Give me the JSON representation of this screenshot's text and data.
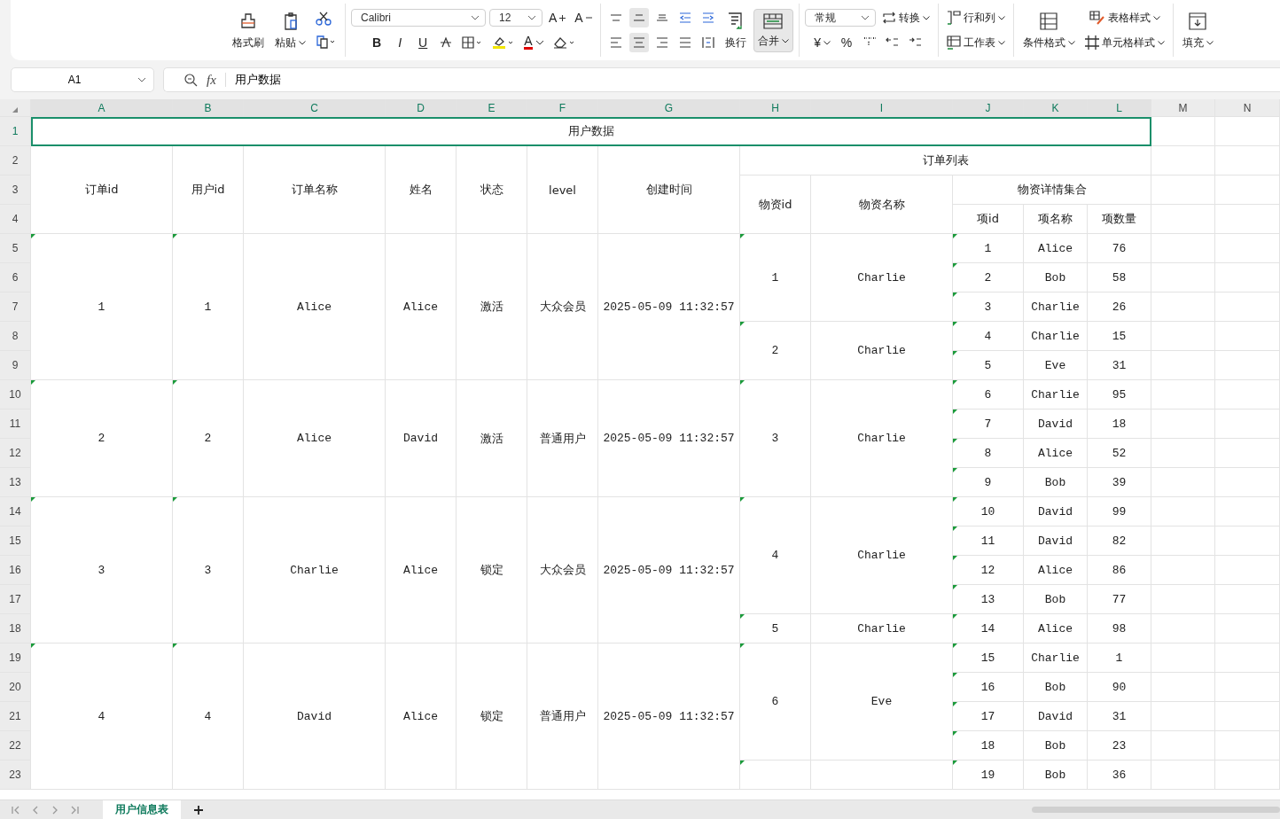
{
  "toolbar": {
    "format_painter": "格式刷",
    "paste": "粘贴",
    "font": "Calibri",
    "font_size": "12",
    "bold": "B",
    "italic": "I",
    "underline": "U",
    "font_grow": "A",
    "font_shrink": "A",
    "font_color": "A",
    "valign": [
      {
        "selected": false
      },
      {
        "selected": true
      },
      {
        "selected": false
      }
    ],
    "halign": [
      {
        "selected": false
      },
      {
        "selected": true
      },
      {
        "selected": false
      },
      {
        "selected": false
      }
    ],
    "wrap": "换行",
    "merge": {
      "label": "合并",
      "selected": true
    },
    "number_format": "常规",
    "convert": "转换",
    "currency": "¥",
    "percent": "%",
    "rows_cols": "行和列",
    "worksheet": "工作表",
    "conditional": "条件格式",
    "table_style": "表格样式",
    "cell_style": "单元格样式",
    "fill": "填充"
  },
  "formula_bar": {
    "cell_ref": "A1",
    "fx": "fx",
    "formula": "用户数据"
  },
  "sheet": {
    "columns": [
      {
        "label": "A",
        "selected": true
      },
      {
        "label": "B",
        "selected": true
      },
      {
        "label": "C",
        "selected": true
      },
      {
        "label": "D",
        "selected": true
      },
      {
        "label": "E",
        "selected": true
      },
      {
        "label": "F",
        "selected": true
      },
      {
        "label": "G",
        "selected": true
      },
      {
        "label": "H",
        "selected": true
      },
      {
        "label": "I",
        "selected": true
      },
      {
        "label": "J",
        "selected": true
      },
      {
        "label": "K",
        "selected": true
      },
      {
        "label": "L",
        "selected": true
      },
      {
        "label": "M",
        "selected": false
      },
      {
        "label": "N",
        "selected": false
      }
    ],
    "rows": [
      {
        "label": "1",
        "selected": true
      },
      {
        "label": "2",
        "selected": false
      },
      {
        "label": "3",
        "selected": false
      },
      {
        "label": "4",
        "selected": false
      },
      {
        "label": "5",
        "selected": false
      },
      {
        "label": "6",
        "selected": false
      },
      {
        "label": "7",
        "selected": false
      },
      {
        "label": "8",
        "selected": false
      },
      {
        "label": "9",
        "selected": false
      },
      {
        "label": "10",
        "selected": false
      },
      {
        "label": "11",
        "selected": false
      },
      {
        "label": "12",
        "selected": false
      },
      {
        "label": "13",
        "selected": false
      },
      {
        "label": "14",
        "selected": false
      },
      {
        "label": "15",
        "selected": false
      },
      {
        "label": "16",
        "selected": false
      },
      {
        "label": "17",
        "selected": false
      },
      {
        "label": "18",
        "selected": false
      },
      {
        "label": "19",
        "selected": false
      },
      {
        "label": "20",
        "selected": false
      },
      {
        "label": "21",
        "selected": false
      },
      {
        "label": "22",
        "selected": false
      },
      {
        "label": "23",
        "selected": false
      }
    ],
    "title": "用户数据",
    "headers": {
      "order_id": "订单id",
      "user_id": "用户id",
      "order_name": "订单名称",
      "name": "姓名",
      "status": "状态",
      "level": "level",
      "created": "创建时间",
      "order_list": "订单列表",
      "material_id": "物资id",
      "material_name": "物资名称",
      "detail": "物资详情集合",
      "item_id": "项id",
      "item_name": "项名称",
      "item_qty": "项数量"
    },
    "orders": [
      {
        "order_id": "1",
        "user_id": "1",
        "order_name": "Alice",
        "name": "Alice",
        "status": "激活",
        "level": "大众会员",
        "created": "2025-05-09 11:32:57",
        "materials": [
          {
            "id": "1",
            "name": "Charlie",
            "items": [
              {
                "id": "1",
                "name": "Alice",
                "qty": "76"
              },
              {
                "id": "2",
                "name": "Bob",
                "qty": "58"
              },
              {
                "id": "3",
                "name": "Charlie",
                "qty": "26"
              }
            ]
          },
          {
            "id": "2",
            "name": "Charlie",
            "items": [
              {
                "id": "4",
                "name": "Charlie",
                "qty": "15"
              },
              {
                "id": "5",
                "name": "Eve",
                "qty": "31"
              }
            ]
          }
        ]
      },
      {
        "order_id": "2",
        "user_id": "2",
        "order_name": "Alice",
        "name": "David",
        "status": "激活",
        "level": "普通用户",
        "created": "2025-05-09 11:32:57",
        "materials": [
          {
            "id": "3",
            "name": "Charlie",
            "items": [
              {
                "id": "6",
                "name": "Charlie",
                "qty": "95"
              },
              {
                "id": "7",
                "name": "David",
                "qty": "18"
              },
              {
                "id": "8",
                "name": "Alice",
                "qty": "52"
              },
              {
                "id": "9",
                "name": "Bob",
                "qty": "39"
              }
            ]
          }
        ]
      },
      {
        "order_id": "3",
        "user_id": "3",
        "order_name": "Charlie",
        "name": "Alice",
        "status": "锁定",
        "level": "大众会员",
        "created": "2025-05-09 11:32:57",
        "materials": [
          {
            "id": "4",
            "name": "Charlie",
            "items": [
              {
                "id": "10",
                "name": "David",
                "qty": "99"
              },
              {
                "id": "11",
                "name": "David",
                "qty": "82"
              },
              {
                "id": "12",
                "name": "Alice",
                "qty": "86"
              },
              {
                "id": "13",
                "name": "Bob",
                "qty": "77"
              }
            ]
          },
          {
            "id": "5",
            "name": "Charlie",
            "items": [
              {
                "id": "14",
                "name": "Alice",
                "qty": "98"
              }
            ]
          }
        ]
      },
      {
        "order_id": "4",
        "user_id": "4",
        "order_name": "David",
        "name": "Alice",
        "status": "锁定",
        "level": "普通用户",
        "created": "2025-05-09 11:32:57",
        "materials": [
          {
            "id": "6",
            "name": "Eve",
            "items": [
              {
                "id": "15",
                "name": "Charlie",
                "qty": "1"
              },
              {
                "id": "16",
                "name": "Bob",
                "qty": "90"
              },
              {
                "id": "17",
                "name": "David",
                "qty": "31"
              },
              {
                "id": "18",
                "name": "Bob",
                "qty": "23"
              }
            ]
          },
          {
            "items": [
              {
                "id": "19",
                "name": "Bob",
                "qty": "36"
              }
            ]
          }
        ]
      }
    ]
  },
  "sheet_tabs": [
    {
      "label": "用户信息表",
      "selected": true
    }
  ]
}
